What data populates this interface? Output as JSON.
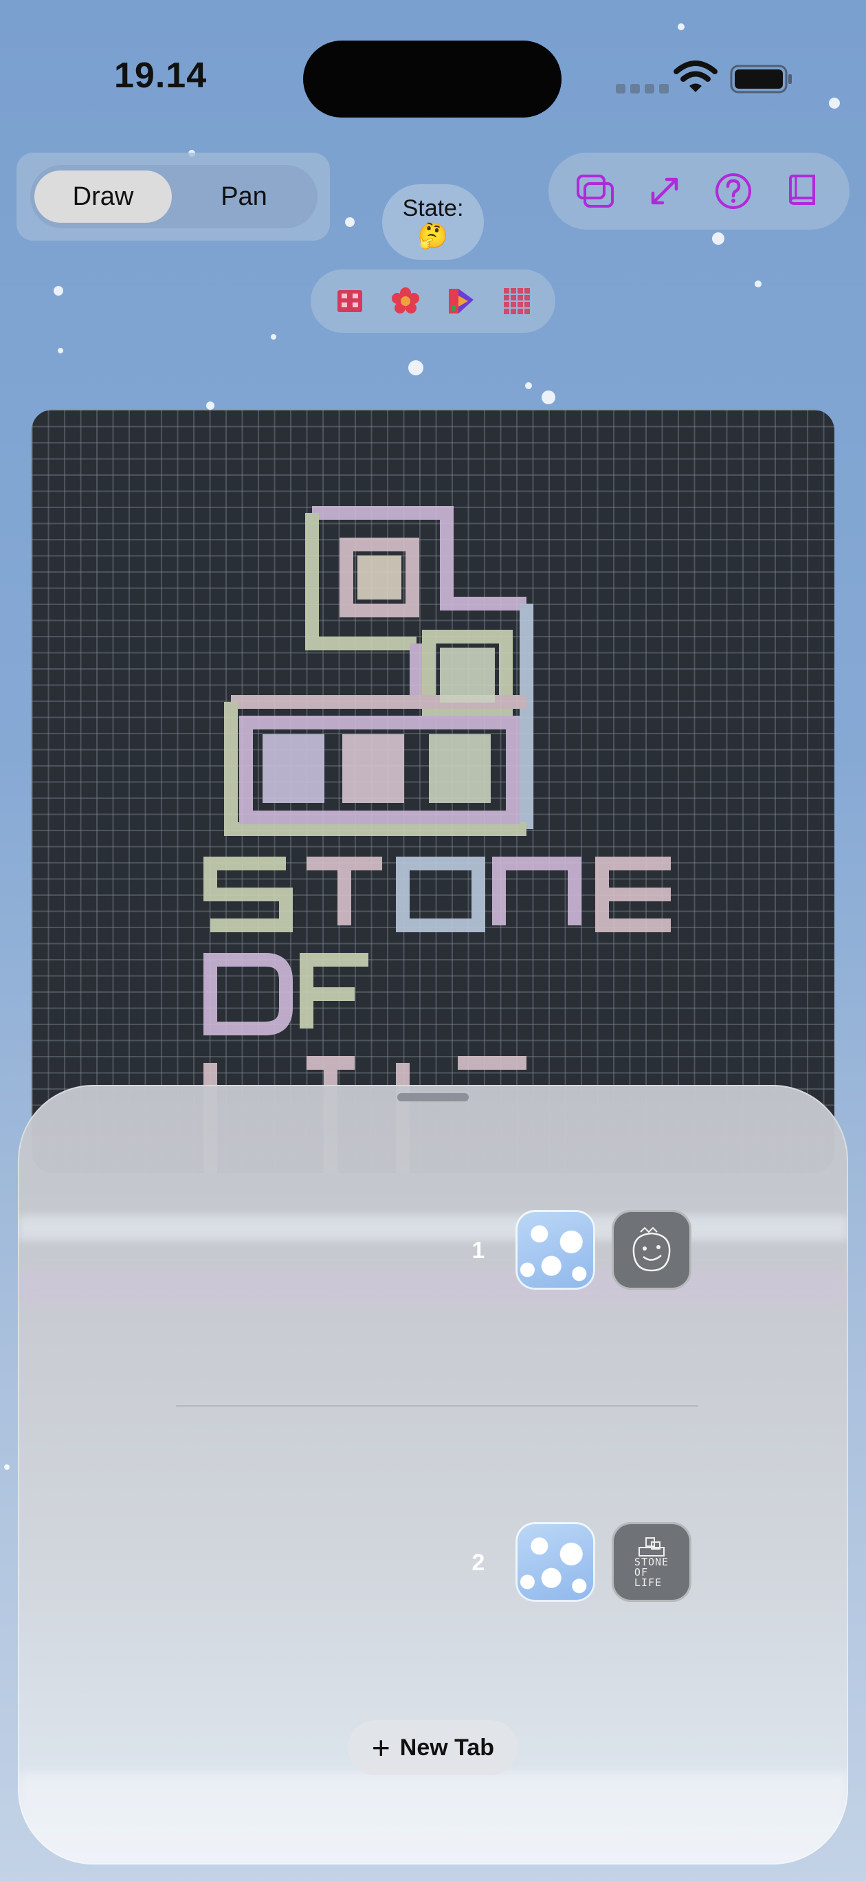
{
  "status_bar": {
    "time": "19.14"
  },
  "mode_toggle": {
    "options": [
      "Draw",
      "Pan"
    ],
    "selected": "Draw"
  },
  "state": {
    "label": "State:",
    "emoji": "🤔"
  },
  "toolbar": {
    "icons": [
      "layers-icon",
      "expand-icon",
      "help-icon",
      "book-icon"
    ],
    "accent_color": "#b02ad9"
  },
  "patterns": {
    "icons": [
      "block-pattern-icon",
      "flower-pattern-icon",
      "ship-pattern-icon",
      "grid-pattern-icon"
    ]
  },
  "canvas": {
    "background_color": "#2a2f36",
    "grid_line_color": "#5d646c"
  },
  "sheet": {
    "tabs": [
      {
        "index": "1",
        "thumbnails": [
          "snow-thumbnail",
          "smiley-thumbnail"
        ]
      },
      {
        "index": "2",
        "thumbnails": [
          "snow-thumbnail",
          "stone-of-life-thumbnail"
        ]
      }
    ],
    "thumbnail_text": [
      "STONE",
      "OF",
      "LIFE"
    ],
    "new_tab_label": "New Tab"
  }
}
